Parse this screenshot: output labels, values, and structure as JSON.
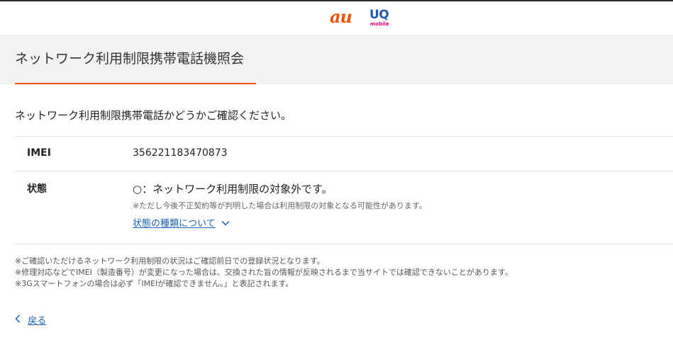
{
  "header": {
    "logo_au": "au",
    "logo_uq_main": "UQ",
    "logo_uq_sub": "mobile"
  },
  "page_title": "ネットワーク利用制限携帯電話機照会",
  "intro": "ネットワーク利用制限携帯電話かどうかご確認ください。",
  "result": {
    "imei_label": "IMEI",
    "imei_value": "356221183470873",
    "status_label": "状態",
    "status_value": "○：ネットワーク利用制限の対象外です。",
    "status_note": "※ただし今後不正契約等が判明した場合は利用制限の対象となる可能性があります。",
    "status_link": "状態の種類について"
  },
  "footnotes": [
    "※ご確認いただけるネットワーク利用制限の状況はご確認前日での登録状況となります。",
    "※修理対応などでIMEI（製造番号）が変更になった場合は、交換された旨の情報が反映されるまで当サイトでは確認できないことがあります。",
    "※3Gスマートフォンの場合は必ず「IMEIが確認できません。」と表記されます。"
  ],
  "back_link": "戻る",
  "colors": {
    "accent_orange": "#eb5505",
    "link_blue": "#1a62b3",
    "uq_blue": "#1d5ab4",
    "uq_magenta": "#e4007f"
  },
  "icons": {
    "status_link_icon": "chevron-down-icon",
    "back_icon": "chevron-left-icon"
  }
}
